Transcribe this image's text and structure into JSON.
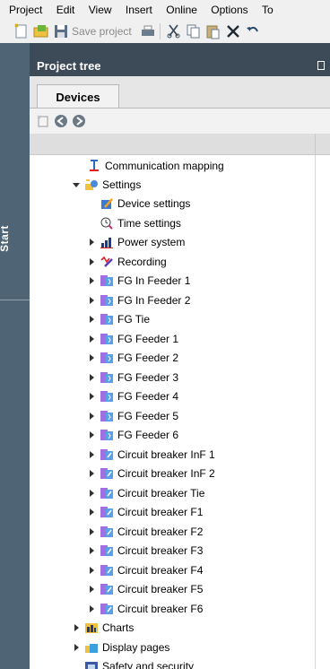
{
  "menubar": {
    "items": [
      "Project",
      "Edit",
      "View",
      "Insert",
      "Online",
      "Options",
      "To"
    ]
  },
  "toolbar": {
    "save_project": "Save project"
  },
  "start_tab": {
    "label": "Start"
  },
  "panel": {
    "title": "Project tree",
    "tab_devices": "Devices"
  },
  "tree": {
    "communication_mapping": "Communication mapping",
    "settings": "Settings",
    "device_settings": "Device settings",
    "time_settings": "Time settings",
    "power_system": "Power system",
    "recording": "Recording",
    "fg_in_feeder_1": "FG In Feeder 1",
    "fg_in_feeder_2": "FG In Feeder 2",
    "fg_tie": "FG Tie",
    "fg_feeder_1": "FG Feeder 1",
    "fg_feeder_2": "FG Feeder 2",
    "fg_feeder_3": "FG Feeder 3",
    "fg_feeder_4": "FG Feeder 4",
    "fg_feeder_5": "FG Feeder 5",
    "fg_feeder_6": "FG Feeder 6",
    "cb_inf_1": "Circuit breaker InF 1",
    "cb_inf_2": "Circuit breaker InF 2",
    "cb_tie": "Circuit breaker Tie",
    "cb_f1": "Circuit breaker F1",
    "cb_f2": "Circuit breaker F2",
    "cb_f3": "Circuit breaker F3",
    "cb_f4": "Circuit breaker F4",
    "cb_f5": "Circuit breaker F5",
    "cb_f6": "Circuit breaker F6",
    "charts": "Charts",
    "display_pages": "Display pages",
    "safety_and_security": "Safety and security"
  }
}
